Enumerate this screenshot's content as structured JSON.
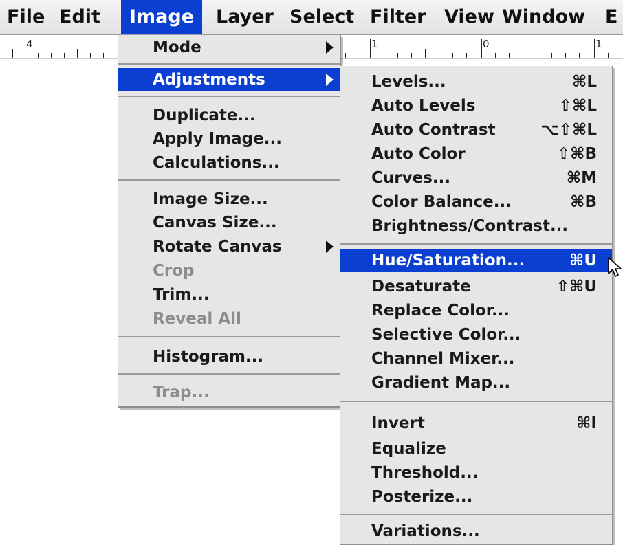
{
  "menubar": {
    "items": [
      {
        "label": "File"
      },
      {
        "label": "Edit"
      },
      {
        "label": "Image"
      },
      {
        "label": "Layer"
      },
      {
        "label": "Select"
      },
      {
        "label": "Filter"
      },
      {
        "label": "View"
      },
      {
        "label": "Window"
      },
      {
        "label": "E"
      }
    ]
  },
  "ruler": {
    "left_label": "4",
    "right_labels": [
      "1",
      "0",
      "1"
    ]
  },
  "image_menu": {
    "items": [
      {
        "label": "Mode"
      },
      {
        "label": "Adjustments"
      },
      {
        "label": "Duplicate..."
      },
      {
        "label": "Apply Image..."
      },
      {
        "label": "Calculations..."
      },
      {
        "label": "Image Size..."
      },
      {
        "label": "Canvas Size..."
      },
      {
        "label": "Rotate Canvas"
      },
      {
        "label": "Crop"
      },
      {
        "label": "Trim..."
      },
      {
        "label": "Reveal All"
      },
      {
        "label": "Histogram..."
      },
      {
        "label": "Trap..."
      }
    ]
  },
  "adjustments_menu": {
    "items": [
      {
        "label": "Levels...",
        "shortcut": "⌘L"
      },
      {
        "label": "Auto Levels",
        "shortcut": "⇧⌘L"
      },
      {
        "label": "Auto Contrast",
        "shortcut": "⌥⇧⌘L"
      },
      {
        "label": "Auto Color",
        "shortcut": "⇧⌘B"
      },
      {
        "label": "Curves...",
        "shortcut": "⌘M"
      },
      {
        "label": "Color Balance...",
        "shortcut": "⌘B"
      },
      {
        "label": "Brightness/Contrast..."
      },
      {
        "label": "Hue/Saturation...",
        "shortcut": "⌘U"
      },
      {
        "label": "Desaturate",
        "shortcut": "⇧⌘U"
      },
      {
        "label": "Replace Color..."
      },
      {
        "label": "Selective Color..."
      },
      {
        "label": "Channel Mixer..."
      },
      {
        "label": "Gradient Map..."
      },
      {
        "label": "Invert",
        "shortcut": "⌘I"
      },
      {
        "label": "Equalize"
      },
      {
        "label": "Threshold..."
      },
      {
        "label": "Posterize..."
      },
      {
        "label": "Variations..."
      }
    ]
  },
  "colors": {
    "highlight": "#0a3fd1",
    "menu_bg": "#e6e6e6",
    "disabled_text": "#8c8c8c"
  }
}
